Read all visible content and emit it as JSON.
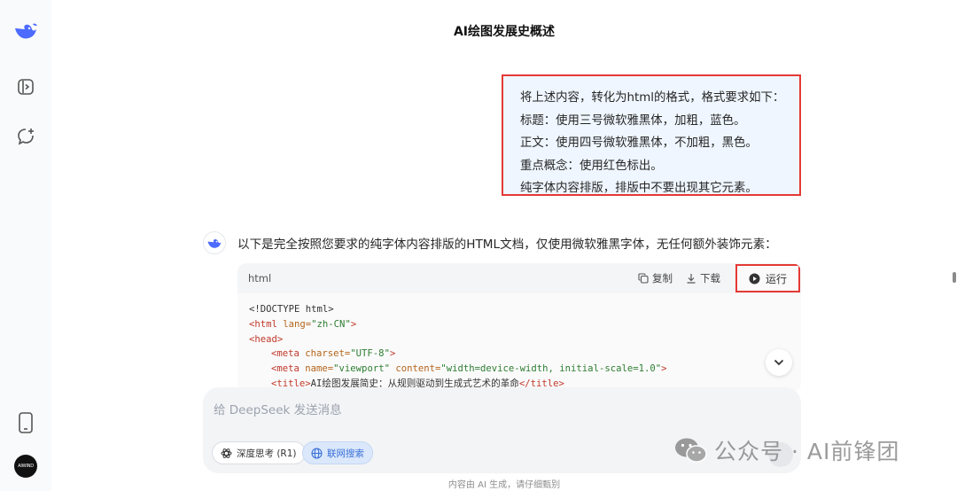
{
  "header": {
    "title": "AI绘图发展史概述"
  },
  "user_message": {
    "lines": [
      "将上述内容，转化为html的格式，格式要求如下：",
      "标题：使用三号微软雅黑体，加粗，蓝色。",
      "正文：使用四号微软雅黑体，不加粗，黑色。",
      "重点概念：使用红色标出。",
      "纯字体内容排版，排版中不要出现其它元素。"
    ]
  },
  "assistant": {
    "intro": "以下是完全按照您要求的纯字体内容排版的HTML文档，仅使用微软雅黑字体，无任何额外装饰元素："
  },
  "code_block": {
    "language": "html",
    "copy_label": "复制",
    "download_label": "下载",
    "run_label": "运行",
    "lines": {
      "l1": "<!DOCTYPE html>",
      "l2_tag_open": "<html",
      "l2_attr": " lang=",
      "l2_val": "\"zh-CN\"",
      "l2_close": ">",
      "l3": "<head>",
      "l4_tag": "<meta",
      "l4_attr": " charset=",
      "l4_val": "\"UTF-8\"",
      "l4_close": ">",
      "l5_tag": "<meta",
      "l5_attr1": " name=",
      "l5_val1": "\"viewport\"",
      "l5_attr2": " content=",
      "l5_val2": "\"width=device-width, initial-scale=1.0\"",
      "l5_close": ">",
      "l6_open": "<title>",
      "l6_text": "AI绘图发展简史：从规则驱动到生成式艺术的革命",
      "l6_close": "</title>"
    }
  },
  "composer": {
    "placeholder": "给 DeepSeek 发送消息",
    "deep_think_label": "深度思考 (R1)",
    "web_search_label": "联网搜索"
  },
  "watermark": {
    "text": "公众号 · AI前锋团"
  },
  "footer": {
    "disclaimer": "内容由 AI 生成，请仔细甄别"
  },
  "sidebar": {
    "avatar_text": "AIWIND"
  },
  "colors": {
    "accent_blue": "#4d6bfe",
    "highlight_red": "#e53935"
  },
  "icons": [
    "deepseek-logo-icon",
    "sidebar-toggle-icon",
    "new-chat-icon",
    "phone-icon",
    "copy-icon",
    "download-icon",
    "play-icon",
    "chevron-down-icon",
    "deep-think-icon",
    "globe-icon",
    "wechat-icon"
  ]
}
